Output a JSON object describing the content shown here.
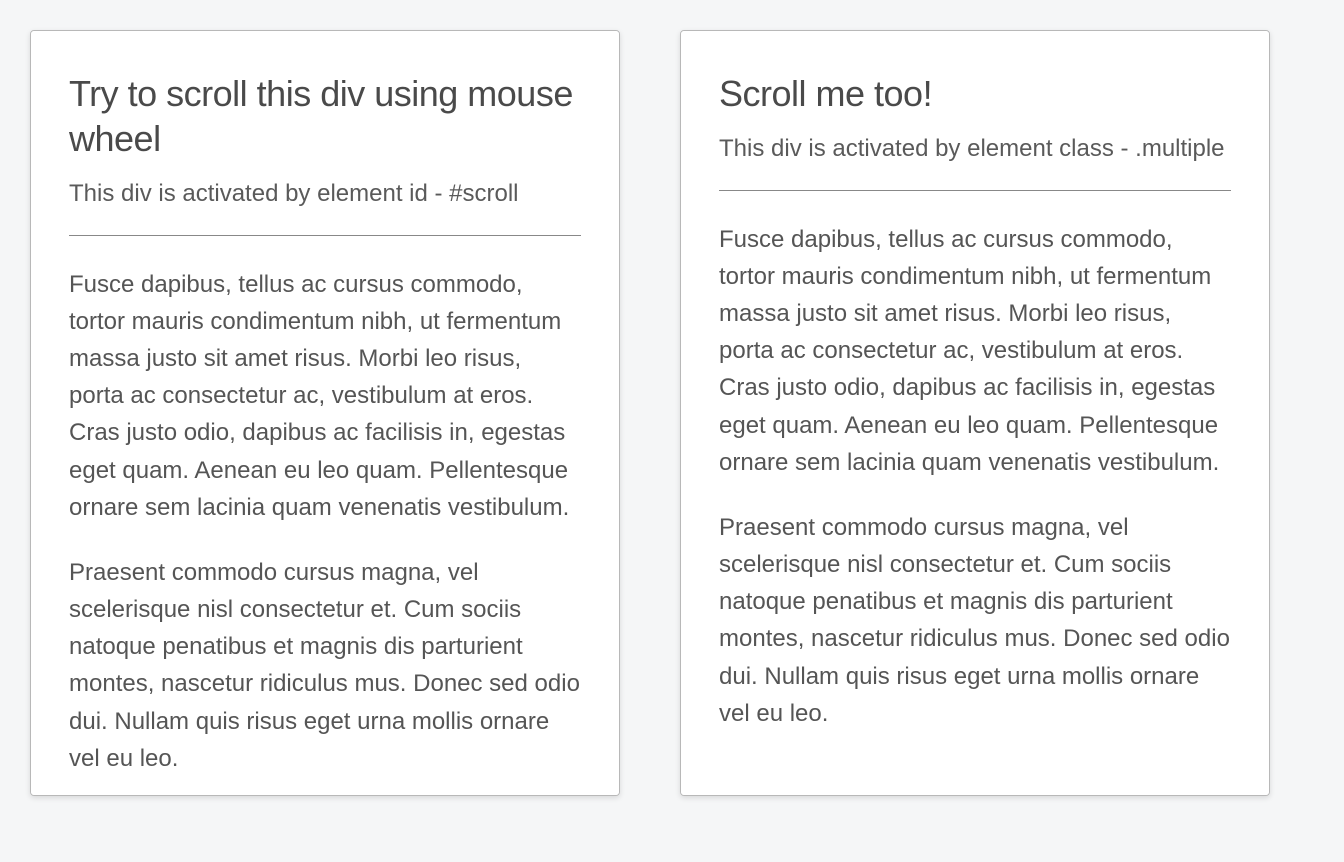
{
  "left": {
    "heading": "Try to scroll this div using mouse wheel",
    "subheading": "This div is activated by element id - #scroll",
    "para1": "Fusce dapibus, tellus ac cursus commodo, tortor mauris condimentum nibh, ut fermentum massa justo sit amet risus. Morbi leo risus, porta ac consectetur ac, vestibulum at eros. Cras justo odio, dapibus ac facilisis in, egestas eget quam. Aenean eu leo quam. Pellentesque ornare sem lacinia quam venenatis vestibulum.",
    "para2": "Praesent commodo cursus magna, vel scelerisque nisl consectetur et. Cum sociis natoque penatibus et magnis dis parturient montes, nascetur ridiculus mus. Donec sed odio dui. Nullam quis risus eget urna mollis ornare vel eu leo."
  },
  "right": {
    "heading": "Scroll me too!",
    "subheading": "This div is activated by element class - .multiple",
    "para1": "Fusce dapibus, tellus ac cursus commodo, tortor mauris condimentum nibh, ut fermentum massa justo sit amet risus. Morbi leo risus, porta ac consectetur ac, vestibulum at eros. Cras justo odio, dapibus ac facilisis in, egestas eget quam. Aenean eu leo quam. Pellentesque ornare sem lacinia quam venenatis vestibulum.",
    "para2": "Praesent commodo cursus magna, vel scelerisque nisl consectetur et. Cum sociis natoque penatibus et magnis dis parturient montes, nascetur ridiculus mus. Donec sed odio dui. Nullam quis risus eget urna mollis ornare vel eu leo."
  }
}
